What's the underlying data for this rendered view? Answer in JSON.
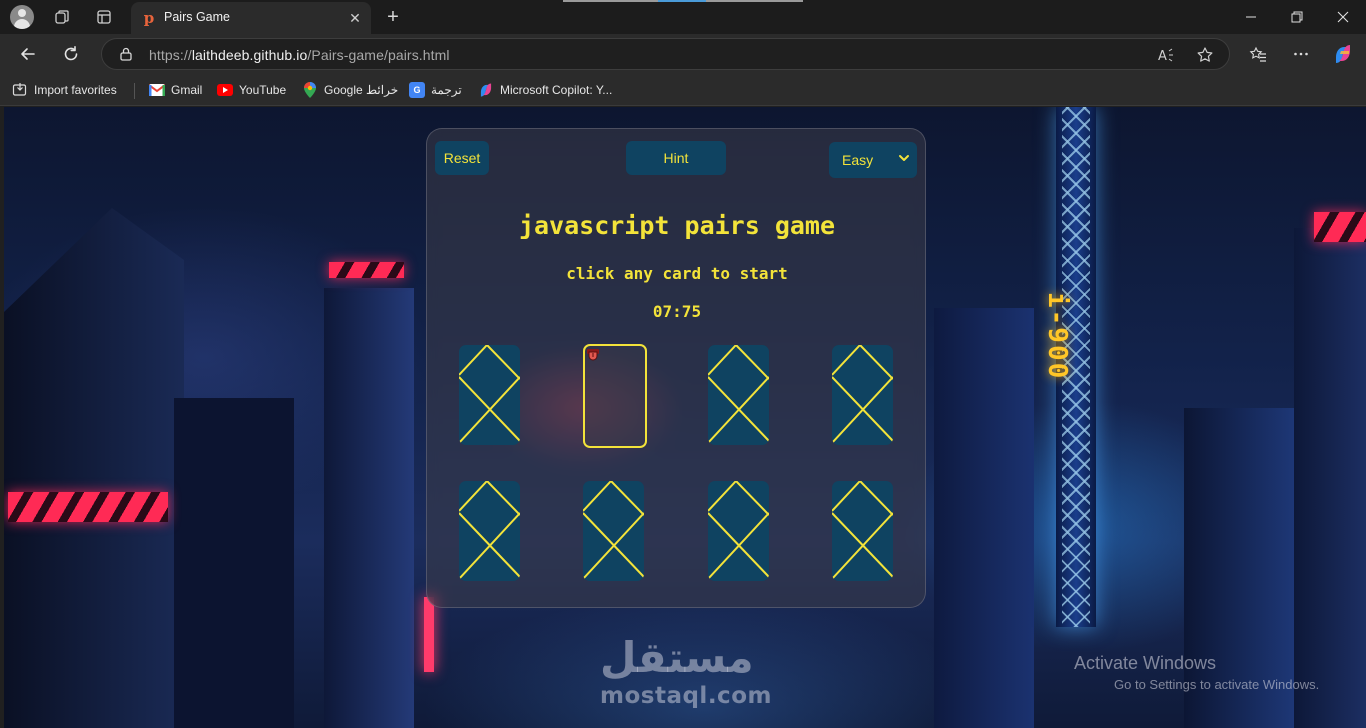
{
  "browser": {
    "tab_title": "Pairs Game",
    "url_scheme": "https://",
    "url_host": "laithdeeb.github.io",
    "url_path": "/Pairs-game/pairs.html",
    "bookmarks": [
      {
        "label": "Import favorites",
        "icon": "import-icon"
      },
      {
        "label": "Gmail",
        "icon": "gmail-icon"
      },
      {
        "label": "YouTube",
        "icon": "youtube-icon"
      },
      {
        "label": "Google خرائط",
        "icon": "google-maps-icon"
      },
      {
        "label": "ترجمة",
        "icon": "google-translate-icon"
      },
      {
        "label": "Microsoft Copilot: Y...",
        "icon": "copilot-icon"
      }
    ]
  },
  "game": {
    "reset_label": "Reset",
    "hint_label": "Hint",
    "difficulty": "Easy",
    "title": "javascript pairs game",
    "subtitle": "click any card to start",
    "timer": "07:75",
    "flipped_card_icon": "tongue-emoji-icon",
    "cards": [
      {
        "state": "face-down"
      },
      {
        "state": "face-up"
      },
      {
        "state": "face-down"
      },
      {
        "state": "face-down"
      },
      {
        "state": "face-down"
      },
      {
        "state": "face-down"
      },
      {
        "state": "face-down"
      },
      {
        "state": "face-down"
      }
    ]
  },
  "overlay": {
    "watermark": "مستقل",
    "watermark_sub": "mostaql.com",
    "activate_title": "Activate Windows",
    "activate_sub": "Go to Settings to activate Windows."
  },
  "colors": {
    "card_bg": "#0f4361",
    "accent_yellow": "#f3e33a",
    "panel_bg": "#3c3c48"
  }
}
